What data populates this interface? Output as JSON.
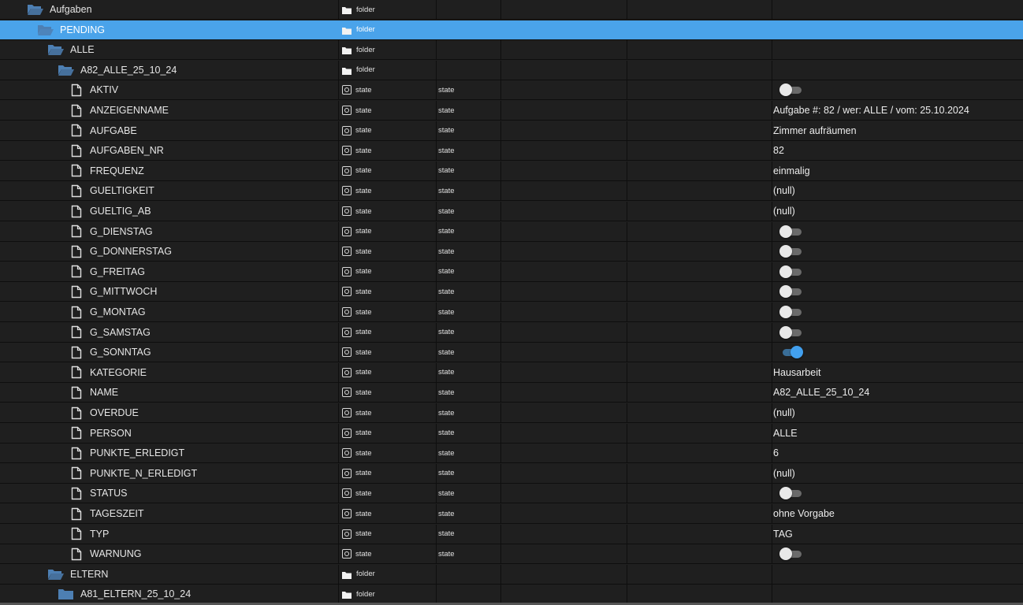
{
  "colors": {
    "selected_row": "#4aa3ea",
    "folder_icon": "#4d7fb3",
    "toggle_on": "#42a0ee",
    "background": "#1f1f1f"
  },
  "rows": [
    {
      "kind": "folder",
      "level": 0,
      "name": "Aufgaben",
      "type": "folder",
      "icon": "folder-open-icon"
    },
    {
      "kind": "folder",
      "level": 1,
      "name": "PENDING",
      "type": "folder",
      "icon": "folder-open-icon",
      "selected": true
    },
    {
      "kind": "folder",
      "level": 2,
      "name": "ALLE",
      "type": "folder",
      "icon": "folder-open-icon"
    },
    {
      "kind": "folder",
      "level": 3,
      "name": "A82_ALLE_25_10_24",
      "type": "folder",
      "icon": "folder-open-icon"
    },
    {
      "kind": "state",
      "name": "AKTIV",
      "type": "state",
      "role": "state",
      "toggle": false
    },
    {
      "kind": "state",
      "name": "ANZEIGENNAME",
      "type": "state",
      "role": "state",
      "value": "Aufgabe #: 82 / wer: ALLE / vom: 25.10.2024"
    },
    {
      "kind": "state",
      "name": "AUFGABE",
      "type": "state",
      "role": "state",
      "value": "Zimmer aufräumen"
    },
    {
      "kind": "state",
      "name": "AUFGABEN_NR",
      "type": "state",
      "role": "state",
      "value": "82"
    },
    {
      "kind": "state",
      "name": "FREQUENZ",
      "type": "state",
      "role": "state",
      "value": "einmalig"
    },
    {
      "kind": "state",
      "name": "GUELTIGKEIT",
      "type": "state",
      "role": "state",
      "value": "(null)"
    },
    {
      "kind": "state",
      "name": "GUELTIG_AB",
      "type": "state",
      "role": "state",
      "value": "(null)"
    },
    {
      "kind": "state",
      "name": "G_DIENSTAG",
      "type": "state",
      "role": "state",
      "toggle": false
    },
    {
      "kind": "state",
      "name": "G_DONNERSTAG",
      "type": "state",
      "role": "state",
      "toggle": false
    },
    {
      "kind": "state",
      "name": "G_FREITAG",
      "type": "state",
      "role": "state",
      "toggle": false
    },
    {
      "kind": "state",
      "name": "G_MITTWOCH",
      "type": "state",
      "role": "state",
      "toggle": false
    },
    {
      "kind": "state",
      "name": "G_MONTAG",
      "type": "state",
      "role": "state",
      "toggle": false
    },
    {
      "kind": "state",
      "name": "G_SAMSTAG",
      "type": "state",
      "role": "state",
      "toggle": false
    },
    {
      "kind": "state",
      "name": "G_SONNTAG",
      "type": "state",
      "role": "state",
      "toggle": true
    },
    {
      "kind": "state",
      "name": "KATEGORIE",
      "type": "state",
      "role": "state",
      "value": "Hausarbeit"
    },
    {
      "kind": "state",
      "name": "NAME",
      "type": "state",
      "role": "state",
      "value": "A82_ALLE_25_10_24"
    },
    {
      "kind": "state",
      "name": "OVERDUE",
      "type": "state",
      "role": "state",
      "value": "(null)"
    },
    {
      "kind": "state",
      "name": "PERSON",
      "type": "state",
      "role": "state",
      "value": "ALLE"
    },
    {
      "kind": "state",
      "name": "PUNKTE_ERLEDIGT",
      "type": "state",
      "role": "state",
      "value": "6"
    },
    {
      "kind": "state",
      "name": "PUNKTE_N_ERLEDIGT",
      "type": "state",
      "role": "state",
      "value": "(null)"
    },
    {
      "kind": "state",
      "name": "STATUS",
      "type": "state",
      "role": "state",
      "toggle": false
    },
    {
      "kind": "state",
      "name": "TAGESZEIT",
      "type": "state",
      "role": "state",
      "value": "ohne Vorgabe"
    },
    {
      "kind": "state",
      "name": "TYP",
      "type": "state",
      "role": "state",
      "value": "TAG"
    },
    {
      "kind": "state",
      "name": "WARNUNG",
      "type": "state",
      "role": "state",
      "toggle": false
    },
    {
      "kind": "folder",
      "level": 2,
      "name": "ELTERN",
      "type": "folder",
      "icon": "folder-open-icon"
    },
    {
      "kind": "folder",
      "level": 3,
      "name": "A81_ELTERN_25_10_24",
      "type": "folder",
      "icon": "folder-closed-icon"
    }
  ]
}
